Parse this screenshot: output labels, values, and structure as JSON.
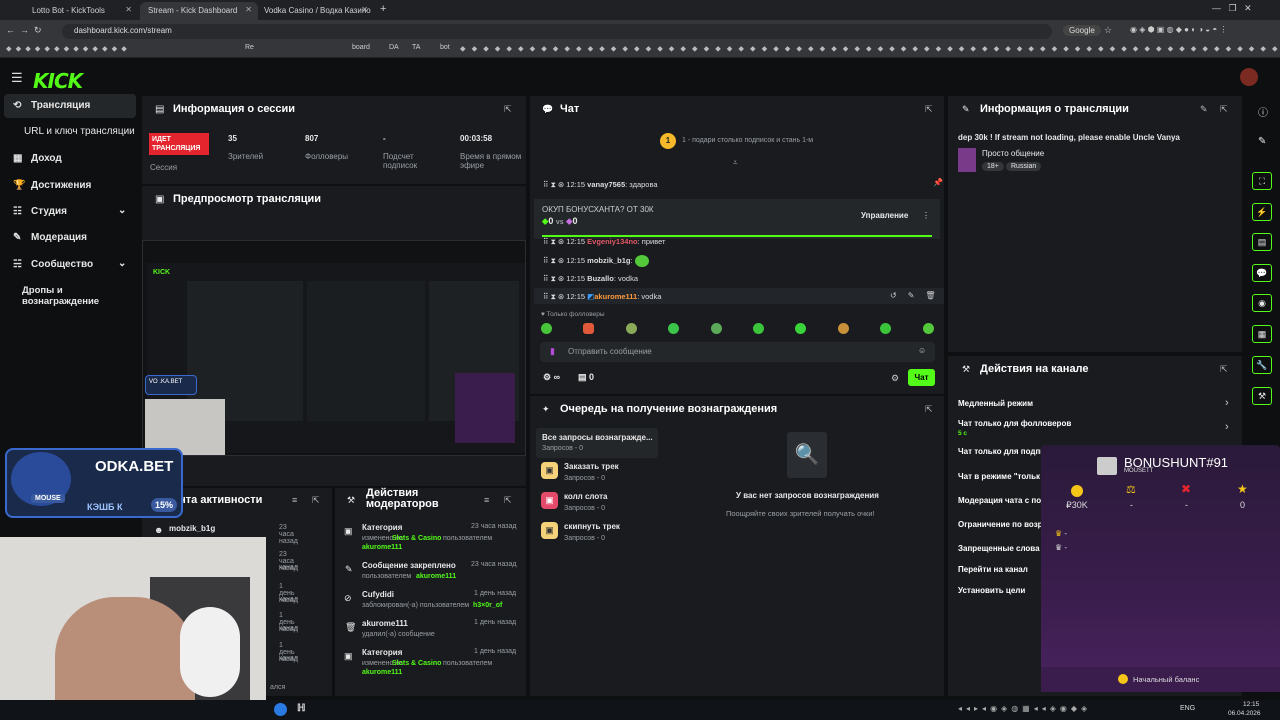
{
  "browser": {
    "tabs": [
      {
        "label": "Lotto Bot - KickTools"
      },
      {
        "label": "Stream - Kick Dashboard"
      },
      {
        "label": "Vodka Casino / Водка Казино"
      }
    ],
    "url": "dashboard.kick.com/stream",
    "search_engine": "Google",
    "bookmarks": [
      "Re",
      "board",
      "DA",
      "TA",
      "bot"
    ]
  },
  "header": {
    "logo": "KICK"
  },
  "sidebar": {
    "items": [
      {
        "label": "Трансляция"
      },
      {
        "label": "URL и ключ трансляции"
      },
      {
        "label": "Доход"
      },
      {
        "label": "Достижения"
      },
      {
        "label": "Студия"
      },
      {
        "label": "Модерация"
      },
      {
        "label": "Сообщество"
      },
      {
        "label": "Дропы и вознаграждение"
      }
    ]
  },
  "session": {
    "title": "Информация о сессии",
    "status": "ИДЕТ ТРАНСЛЯЦИЯ",
    "status_label": "Сессия",
    "viewers": "35",
    "viewers_label": "Зрителей",
    "followers": "807",
    "followers_label": "Фолловеры",
    "subs": "-",
    "subs_label": "Подсчет подписок",
    "time": "00:03:58",
    "time_label": "Время в прямом эфире"
  },
  "preview": {
    "title": "Предпросмотр трансляции",
    "overlay_text": "VO .KA.BET",
    "brand": "ODKA.BET",
    "mouse": "MOUSE",
    "cashback": "КЭШБ К",
    "cashback_pct": "15%"
  },
  "activity": {
    "title": "ента активности",
    "rows": [
      {
        "user": "mobzik_b1g",
        "time": "23 часа назад"
      },
      {
        "user": "",
        "time": "23 часа назад",
        "extra": "канал"
      },
      {
        "user": "",
        "time": "1 день назад",
        "extra": "канал"
      },
      {
        "user": "",
        "time": "1 день назад",
        "extra": "канал"
      },
      {
        "user": "",
        "time": "1 день назад",
        "extra": "канал"
      }
    ],
    "subs_label": "ался"
  },
  "mod_actions": {
    "title": "Действия модераторов",
    "rows": [
      {
        "title": "Категория",
        "time": "23 часа назад",
        "line1": "изменено на",
        "hl": "Slots & Casino",
        "line2": "пользователем",
        "user": "akurome111"
      },
      {
        "title": "Сообщение закреплено",
        "time": "23 часа назад",
        "line1": "пользователем",
        "hl": "",
        "line2": "",
        "user": "akurome111"
      },
      {
        "title": "Cufydidi",
        "time": "1 день назад",
        "line1": "заблокирован(-а) пользователем",
        "hl": "",
        "line2": "",
        "user": "h3×0r_of"
      },
      {
        "title": "akurome111",
        "time": "1 день назад",
        "line1": "удалил(-а) сообщение",
        "hl": "",
        "line2": "",
        "user": ""
      },
      {
        "title": "Категория",
        "time": "1 день назад",
        "line1": "изменено на",
        "hl": "Slots & Casino",
        "line2": "пользователем",
        "user": "akurome111"
      }
    ]
  },
  "chat": {
    "title": "Чат",
    "gift_banner": "1 - подари столько подписок и стань 1-м",
    "gift_badge": "1",
    "pinned": {
      "time": "12:15",
      "user": "vanay7565",
      "text": "здарова"
    },
    "poll": {
      "title": "ОКУП БОНУСХАНТА? ОТ 30К",
      "yes": "0",
      "vs": "vs",
      "no": "0",
      "manage": "Управление"
    },
    "messages": [
      {
        "time": "12:15",
        "user": "Evgeniy134no",
        "text": "привет",
        "color": "#e05a66"
      },
      {
        "time": "12:15",
        "user": "mobzik_b1g",
        "text": "",
        "color": "#ddd"
      },
      {
        "time": "12:15",
        "user": "Buzallo",
        "text": "vodka",
        "color": "#ddd"
      },
      {
        "time": "12:15",
        "user": "akurome111",
        "text": "vodka",
        "color": "#ff9a3c"
      }
    ],
    "followers_only": "Только фолловеры",
    "input_placeholder": "Отправить сообщение",
    "infinity": "∞",
    "count": "0",
    "send_label": "Чат"
  },
  "rewards": {
    "title": "Очередь на получение вознаграждения",
    "tabs": [
      {
        "title": "Все запросы вознагражде...",
        "sub": "Запросов - 0"
      },
      {
        "title": "Заказать трек",
        "sub": "Запросов - 0"
      },
      {
        "title": "колл слота",
        "sub": "Запросов - 0"
      },
      {
        "title": "скипнуть трек",
        "sub": "Запросов - 0"
      }
    ],
    "empty_title": "У вас нет запросов вознаграждения",
    "empty_sub": "Поощряйте своих зрителей получать очки!"
  },
  "stream_info": {
    "title": "Информация о трансляции",
    "stream_title": "dep 30k ! If stream not loading, please enable Uncle Vanya",
    "category": "Просто общение",
    "tags": [
      "18+",
      "Russian"
    ]
  },
  "channel_actions": {
    "title": "Действия на канале",
    "items": [
      {
        "label": "Медленный режим",
        "sub": ""
      },
      {
        "label": "Чат только для фолловеров",
        "sub": "5 с"
      },
      {
        "label": "Чат только для подпи",
        "sub": ""
      },
      {
        "label": "Чат в режиме \"тольк",
        "sub": ""
      },
      {
        "label": "Модерация чата с по",
        "sub": ""
      },
      {
        "label": "Ограничение по возр",
        "sub": ""
      },
      {
        "label": "Запрещенные слова",
        "sub": ""
      },
      {
        "label": "Перейти на канал",
        "sub": ""
      },
      {
        "label": "Установить цели",
        "sub": ""
      }
    ]
  },
  "bonushunt": {
    "title": "BONUSHUNT#91",
    "subtitle": "MOUSETT",
    "stats": [
      {
        "icon": "coin",
        "value": "₽30K"
      },
      {
        "icon": "scales",
        "value": "-"
      },
      {
        "icon": "cross",
        "value": "-"
      },
      {
        "icon": "star",
        "value": "0"
      }
    ],
    "crowns": [
      "-",
      "-"
    ],
    "footer": "Начальный баланс"
  },
  "taskbar": {
    "lang": "ENG",
    "time": "12:15",
    "date": "06.04.2026"
  },
  "colors": {
    "accent": "#53fc18",
    "live": "#e4252e",
    "panel": "#191b1f",
    "bg": "#0d0f10"
  }
}
